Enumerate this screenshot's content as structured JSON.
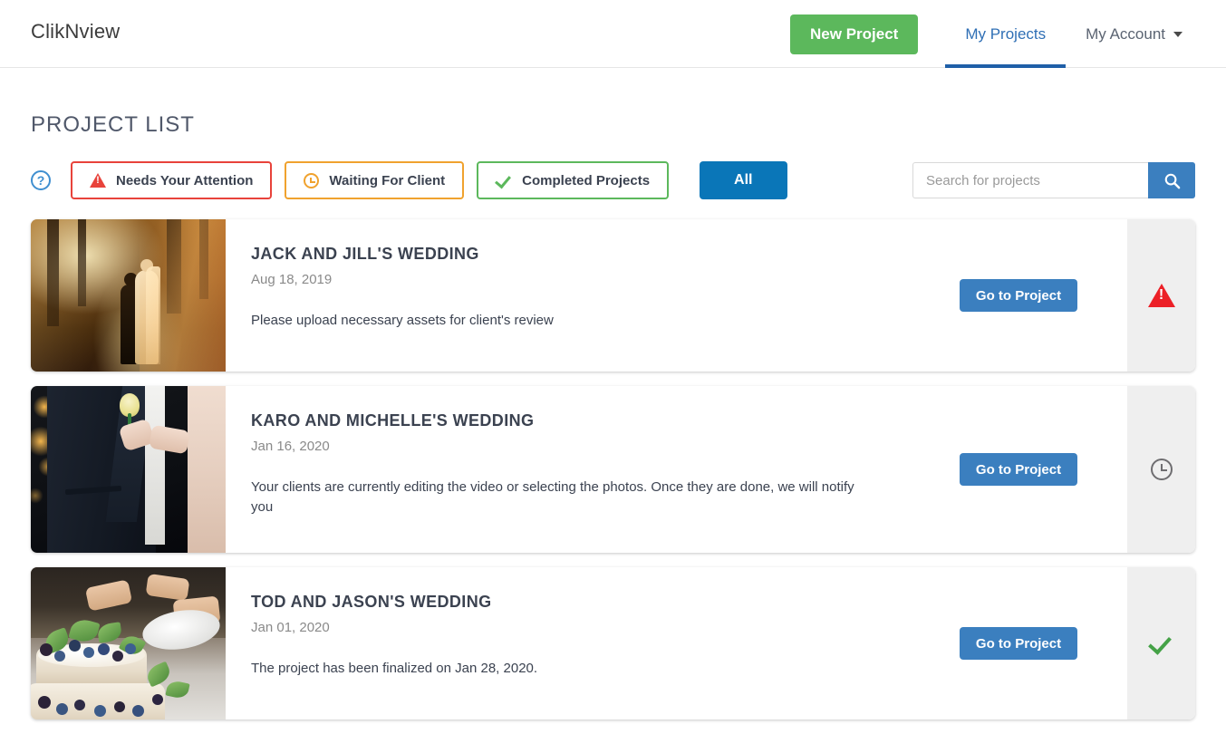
{
  "header": {
    "brand": "ClikNview",
    "new_project_label": "New Project",
    "tabs": [
      {
        "label": "My Projects",
        "active": true
      },
      {
        "label": "My Account",
        "active": false,
        "has_caret": true
      }
    ]
  },
  "page": {
    "title": "PROJECT LIST"
  },
  "filters": {
    "help_icon": "question-mark-icon",
    "chips": [
      {
        "label": "Needs Your Attention",
        "icon": "warning-triangle-icon",
        "color": "#e8433b"
      },
      {
        "label": "Waiting For Client",
        "icon": "clock-icon",
        "color": "#f0a22e"
      },
      {
        "label": "Completed Projects",
        "icon": "check-icon",
        "color": "#5cb85c"
      }
    ],
    "all_label": "All",
    "all_active": true,
    "all_color": "#0a76b8"
  },
  "search": {
    "placeholder": "Search for projects",
    "value": "",
    "icon": "search-icon",
    "button_color": "#3b7fbf"
  },
  "projects": [
    {
      "title": "JACK AND JILL'S WEDDING",
      "date": "Aug 18, 2019",
      "description": "Please upload necessary assets for client's review",
      "action_label": "Go to Project",
      "status_icon": "warning-triangle-icon",
      "status_color": "#ec2027",
      "thumb_alt": "bride-and-groom-at-sunset-photo"
    },
    {
      "title": "KARO AND MICHELLE'S WEDDING",
      "date": "Jan 16, 2020",
      "description": "Your clients are currently editing the video or selecting the photos. Once they are done, we will notify you",
      "action_label": "Go to Project",
      "status_icon": "clock-icon",
      "status_color": "#6e6d70",
      "thumb_alt": "groom-in-suit-holding-hands-photo"
    },
    {
      "title": "TOD AND JASON'S WEDDING",
      "date": "Jan 01, 2020",
      "description": "The project has been finalized on Jan 28, 2020.",
      "action_label": "Go to Project",
      "status_icon": "check-icon",
      "status_color": "#45a247",
      "thumb_alt": "berry-wedding-cake-photo"
    }
  ]
}
